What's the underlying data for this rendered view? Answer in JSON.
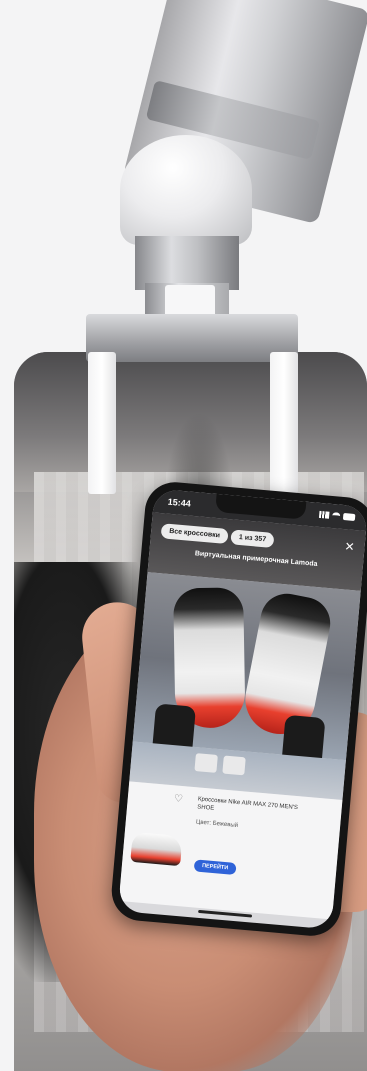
{
  "phone": {
    "status": {
      "time": "15:44"
    },
    "header": {
      "all_label": "Все кроссовки",
      "counter": "1 из 357",
      "title": "Виртуальная примерочная Lamoda"
    },
    "product": {
      "name": "Кроссовки Nike AIR MAX 270 MEN'S SHOE",
      "color": "Цвет: Бежевый",
      "button_label": "ПЕРЕЙТИ"
    }
  },
  "colors": {
    "accent": "#2f63d8",
    "sole": "#e8402e",
    "background": "#f4f4f5"
  },
  "icons": {
    "close": "close-icon",
    "favorite": "heart-icon"
  }
}
